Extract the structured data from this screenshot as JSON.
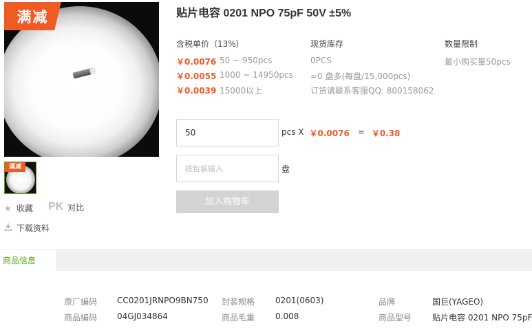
{
  "product": {
    "title": "贴片电容 0201 NPO 75pF 50V ±5%",
    "promo_badge": "满减",
    "thumb_badge": "满减"
  },
  "side_actions": {
    "favorite_label": "收藏",
    "compare_prefix": "PK",
    "compare_label": "对比",
    "download_label": "下载资料"
  },
  "pricing": {
    "header": "含税单价（13%）",
    "tiers": [
      {
        "price": "￥0.0076",
        "range": "50 ~ 950pcs"
      },
      {
        "price": "￥0.0055",
        "range": "1000 ~ 14950pcs"
      },
      {
        "price": "￥0.0039",
        "range": "15000以上"
      }
    ]
  },
  "stock": {
    "header": "现货库存",
    "lines": [
      "0PCS",
      "≈0 盘多(每盘/15,000pcs)",
      "订货请联系客服QQ: 800158062"
    ]
  },
  "limit": {
    "header": "数量限制",
    "text": "最小购买量50pcs"
  },
  "order": {
    "quantity_value": "50",
    "quantity_unit": "pcs X",
    "unit_price": "￥0.0076",
    "equals": "=",
    "total": "￥0.38",
    "pack_placeholder": "按包装输入",
    "pack_unit": "盘",
    "add_to_cart_label": "加入购物车"
  },
  "tabs": {
    "active_label": "商品信息"
  },
  "specs": [
    {
      "label": "原厂编码",
      "value": "CC0201JRNPO9BN750"
    },
    {
      "label": "封装规格",
      "value": "0201(0603)"
    },
    {
      "label": "品牌",
      "value": "国巨(YAGEO)"
    },
    {
      "label": "商品编码",
      "value": "04GJ034864"
    },
    {
      "label": "商品毛重",
      "value": "0.008"
    },
    {
      "label": "商品型号",
      "value": "贴片电容 0201 NPO 75pF..."
    }
  ],
  "colors": {
    "accent_orange": "#f05a23",
    "accent_green": "#53a017",
    "button_disabled": "#d3d3d3"
  }
}
